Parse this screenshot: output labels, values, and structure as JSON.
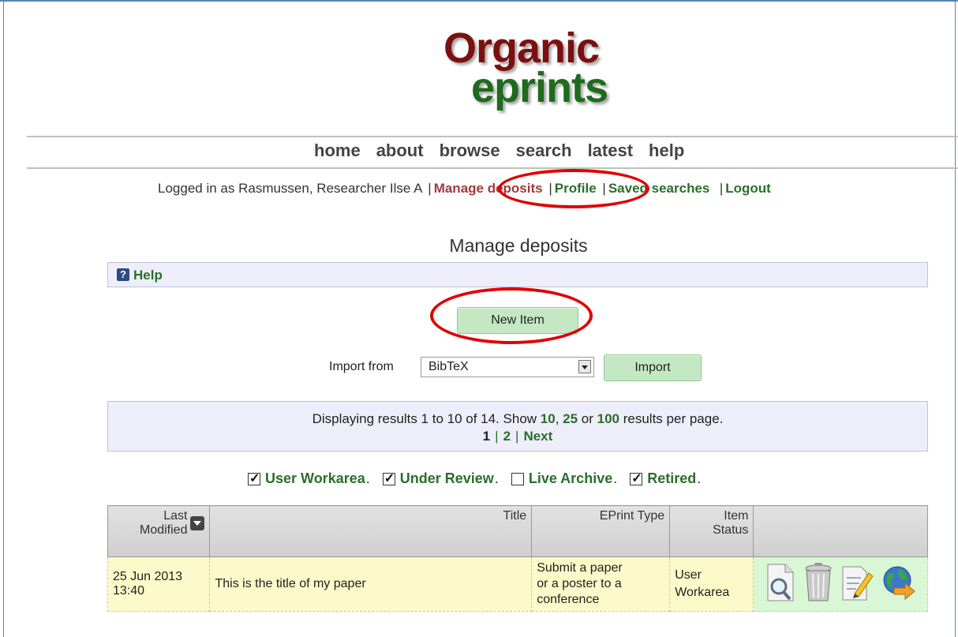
{
  "logo": {
    "line1": "Organic",
    "line2": "eprints"
  },
  "nav": {
    "items": [
      "home",
      "about",
      "browse",
      "search",
      "latest",
      "help"
    ]
  },
  "userbar": {
    "logged_in": "Logged in as Rasmussen, Researcher Ilse A",
    "manage": "Manage deposits",
    "profile": "Profile",
    "saved": "Saved searches",
    "logout": "Logout"
  },
  "page": {
    "title": "Manage deposits"
  },
  "help": {
    "label": "Help",
    "icon": "question-icon"
  },
  "new_item": {
    "label": "New Item"
  },
  "import": {
    "label": "Import from",
    "selected": "BibTeX",
    "button": "Import"
  },
  "results": {
    "prefix": "Displaying results 1 to 10 of 14. Show",
    "opt1": "10",
    "mid": ", ",
    "opt2": "25",
    "or": " or ",
    "opt3": "100",
    "suffix": " results per page.",
    "page1": "1",
    "page2": "2",
    "next": "Next"
  },
  "filters": [
    {
      "label": "User Workarea",
      "checked": true
    },
    {
      "label": "Under Review",
      "checked": true
    },
    {
      "label": "Live Archive",
      "checked": false
    },
    {
      "label": "Retired",
      "checked": true
    }
  ],
  "table": {
    "headers": {
      "modified_line1": "Last",
      "modified_line2": "Modified",
      "title": "Title",
      "type": "EPrint Type",
      "status_line1": "Item",
      "status_line2": "Status"
    },
    "rows": [
      {
        "date": "25 Jun 2013",
        "time": "13:40",
        "title": "This is the title of my paper",
        "type_lines": [
          "Submit a paper",
          "or a poster to a",
          "conference"
        ],
        "status_lines": [
          "User",
          "Workarea"
        ],
        "actions": [
          "view-icon",
          "delete-icon",
          "edit-icon",
          "deposit-icon"
        ]
      }
    ]
  },
  "colors": {
    "link": "#2b6e2b",
    "active_link": "#a33a3a",
    "annotation": "#e00000",
    "button": "#c4e8c4"
  }
}
